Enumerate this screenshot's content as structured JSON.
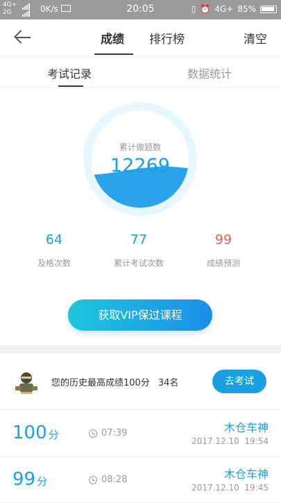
{
  "status_bar": {
    "network_top": "4G+",
    "network_bottom": "2G",
    "speed": "0K/s",
    "time": "20:05",
    "network_right": "4G+",
    "battery": "85%"
  },
  "nav": {
    "tab_scores": "成绩",
    "tab_ranking": "排行榜",
    "clear": "清空"
  },
  "subtabs": {
    "exam_records": "考试记录",
    "statistics": "数据统计"
  },
  "gauge": {
    "label": "累计做题数",
    "value": "12269",
    "fill_fraction": 0.38,
    "color": "#2aa3ea"
  },
  "stats": [
    {
      "value": "64",
      "label": "及格次数"
    },
    {
      "value": "77",
      "label": "累计考试次数"
    },
    {
      "value": "99",
      "label": "成绩预测"
    }
  ],
  "vip_button": "获取VIP保过课程",
  "best": {
    "text": "您的历史最高成绩100分",
    "rank": "34名",
    "button": "去考试"
  },
  "records": [
    {
      "score": "100",
      "unit": "分",
      "duration": "07:39",
      "name": "木仓车神",
      "date": "2017.12.10",
      "time": "19:54"
    },
    {
      "score": "99",
      "unit": "分",
      "duration": "08:28",
      "name": "木仓车神",
      "date": "2017.12.10",
      "time": "19:45"
    }
  ],
  "colors": {
    "accent": "#1aa0e0",
    "predict": "#e85f55"
  }
}
